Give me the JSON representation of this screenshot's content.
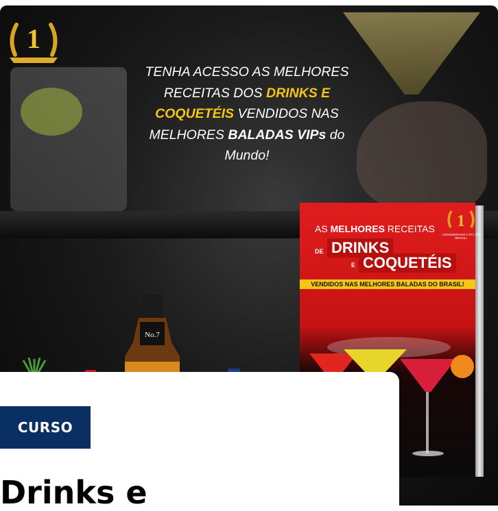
{
  "hero": {
    "headline": {
      "p1": "TENHA ACESSO AS MELHORES RECEITAS DOS ",
      "h1": "DRINKS E COQUETÉIS",
      "p2": " VENDIDOS NAS MELHORES ",
      "h2": "BALADAS VIPs",
      "p3": " do Mundo!"
    },
    "award_number": "1",
    "bottle_label": "No.7"
  },
  "ebook": {
    "line1_prefix": "AS ",
    "line1_bold": "MELHORES",
    "line1_suffix": " RECEITAS",
    "de": "DE",
    "drinks": "DRINKS",
    "e": "E",
    "coqueteis": "COQUETÉIS",
    "band": "VENDIDOS NAS MELHORES BALADAS DO BRASIL!",
    "award_number": "1",
    "award_text": "CONSIDERADO O Nº1 DO BRASIL!"
  },
  "card": {
    "badge": "CURSO",
    "title": "Drinks e"
  },
  "colors": {
    "badge_bg": "#0a2f63",
    "highlight": "#f5c518",
    "ebook_red": "#e11d1d"
  }
}
